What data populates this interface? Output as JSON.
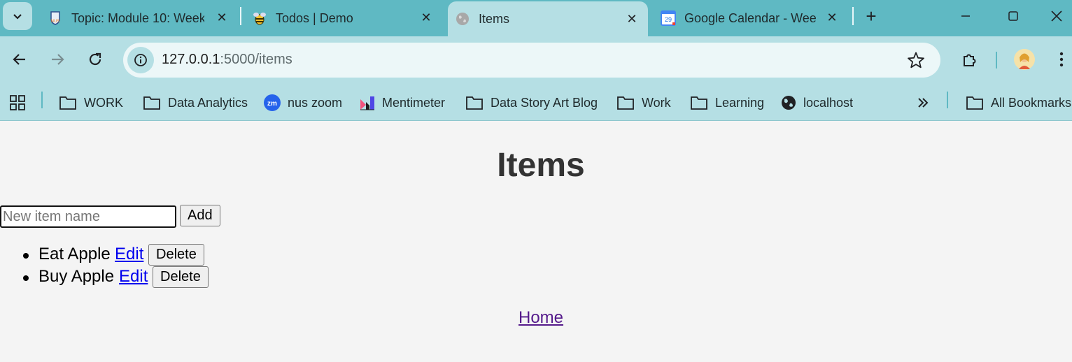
{
  "tabs": [
    {
      "title": "Topic: Module 10: Week",
      "active": false,
      "favicon": "nus-logo-icon"
    },
    {
      "title": "Todos | Demo",
      "active": false,
      "favicon": "bee-icon"
    },
    {
      "title": "Items",
      "active": true,
      "favicon": "globe-icon"
    },
    {
      "title": "Google Calendar - Wee",
      "active": false,
      "favicon": "calendar-icon"
    }
  ],
  "calendar_day": "29",
  "address": {
    "host": "127.0.0.1",
    "path": ":5000/items"
  },
  "bookmarks": [
    "WORK",
    "Data Analytics",
    "nus zoom",
    "Mentimeter",
    "Data Story Art Blog",
    "Work",
    "Learning",
    "localhost",
    "All Bookmarks"
  ],
  "zoom_badge": "zm",
  "page": {
    "heading": "Items",
    "new_item_placeholder": "New item name",
    "add_label": "Add",
    "items": [
      {
        "name": "Eat Apple",
        "edit": "Edit",
        "delete": "Delete"
      },
      {
        "name": "Buy Apple",
        "edit": "Edit",
        "delete": "Delete"
      }
    ],
    "home_link": "Home"
  },
  "colors": {
    "tabstrip": "#5fb9c3",
    "toolbar": "#b5dfe4",
    "link": "#0000ee",
    "visited_link": "#551a8b"
  }
}
